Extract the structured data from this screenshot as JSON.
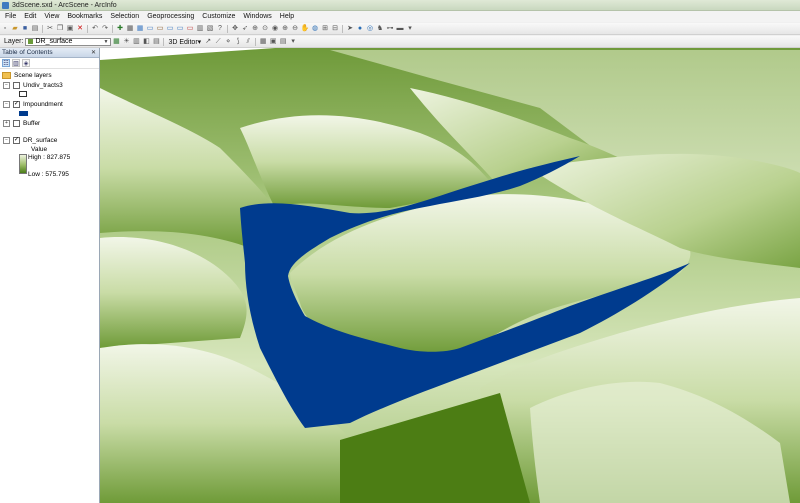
{
  "window": {
    "title": "3dScene.sxd - ArcScene - ArcInfo"
  },
  "menu": [
    "File",
    "Edit",
    "View",
    "Bookmarks",
    "Selection",
    "Geoprocessing",
    "Customize",
    "Windows",
    "Help"
  ],
  "toolbar2": {
    "layer_label": "Layer:",
    "layer_value": "DR_surface",
    "editor_label": "3D Editor▾"
  },
  "toc": {
    "header": "Table of Contents",
    "root_label": "Scene layers",
    "layers": [
      {
        "name": "Undiv_tracts3",
        "checked": false
      },
      {
        "name": "Impoundment",
        "checked": true
      },
      {
        "name": "Buffer",
        "checked": false
      },
      {
        "name": "DR_surface",
        "checked": true
      }
    ],
    "legend": {
      "title": "Value",
      "high": "High : 827.875",
      "low": "Low : 575.795"
    }
  },
  "colors": {
    "water": "#003b8e",
    "terrain_high": "#f1f5e6",
    "terrain_low": "#4c7d14",
    "sky": "#ffffff"
  },
  "icons": [
    "new-icon",
    "open-icon",
    "save-icon",
    "print-icon",
    "cut-icon",
    "copy-icon",
    "paste-icon",
    "delete-icon",
    "undo-icon",
    "redo-icon",
    "add-data-icon",
    "navigate-icon",
    "fly-icon",
    "zoom-in-icon",
    "zoom-out-icon",
    "pan-icon",
    "full-extent-icon",
    "select-icon",
    "identify-icon",
    "find-icon",
    "measure-icon"
  ]
}
